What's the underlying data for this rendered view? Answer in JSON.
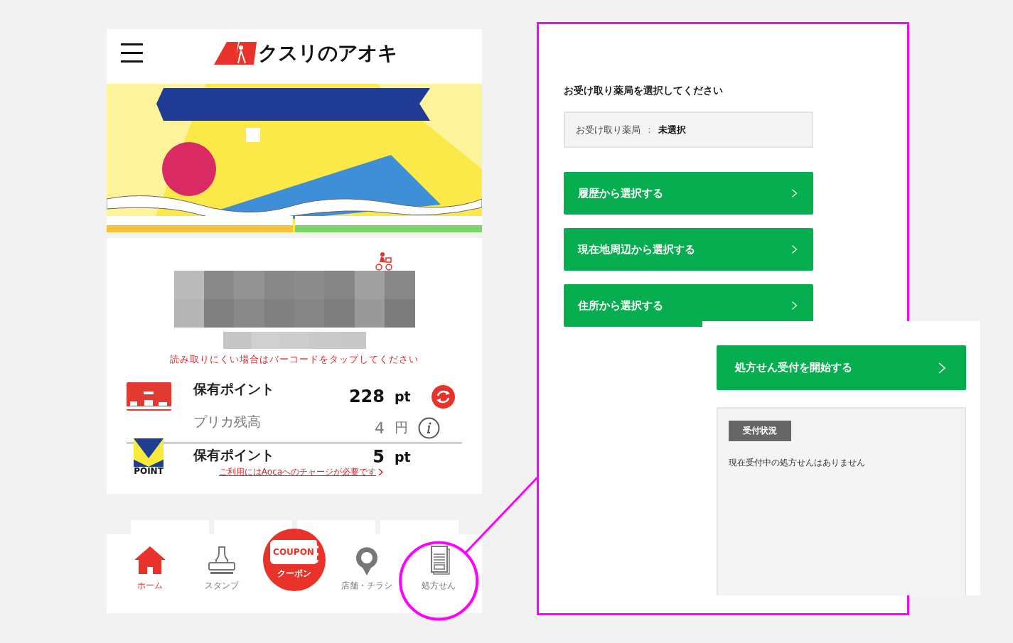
{
  "app": {
    "logo_text": "クスリのアオキ",
    "barcode_hint": "読み取りにくい場合はバーコードをタップしてください",
    "balances": [
      {
        "kind": "aoca",
        "label": "保有ポイント",
        "value": "228",
        "unit": "pt"
      },
      {
        "kind": "prepaid",
        "label": "プリカ残高",
        "value": "4",
        "unit": "円"
      },
      {
        "kind": "vpoint",
        "label": "保有ポイント",
        "value": "5",
        "unit": "pt",
        "logo_text": "POINT",
        "link": "ご利用にはAocaへのチャージが必要です"
      }
    ],
    "nav": [
      {
        "kind": "home",
        "label": "ホーム",
        "selected": true,
        "highlighted": false
      },
      {
        "kind": "stamp",
        "label": "スタンプ",
        "selected": false,
        "highlighted": false
      },
      {
        "kind": "coupon",
        "label": "クーポン",
        "badge": "COUPON",
        "selected": false,
        "highlighted": false
      },
      {
        "kind": "pin",
        "label": "店舗・チラシ",
        "selected": false,
        "highlighted": false
      },
      {
        "kind": "document",
        "label": "処方せん",
        "selected": false,
        "highlighted": true
      }
    ]
  },
  "panel": {
    "title": "お受け取り薬局を選択してください",
    "field": {
      "label": "お受け取り薬局",
      "separator": "：",
      "value": "未選択"
    },
    "buttons": [
      "履歴から選択する",
      "現在地周辺から選択する",
      "住所から選択する"
    ],
    "start_button": "処方せん受付を開始する",
    "status": {
      "badge": "受付状況",
      "message": "現在受付中の処方せんはありません"
    }
  }
}
